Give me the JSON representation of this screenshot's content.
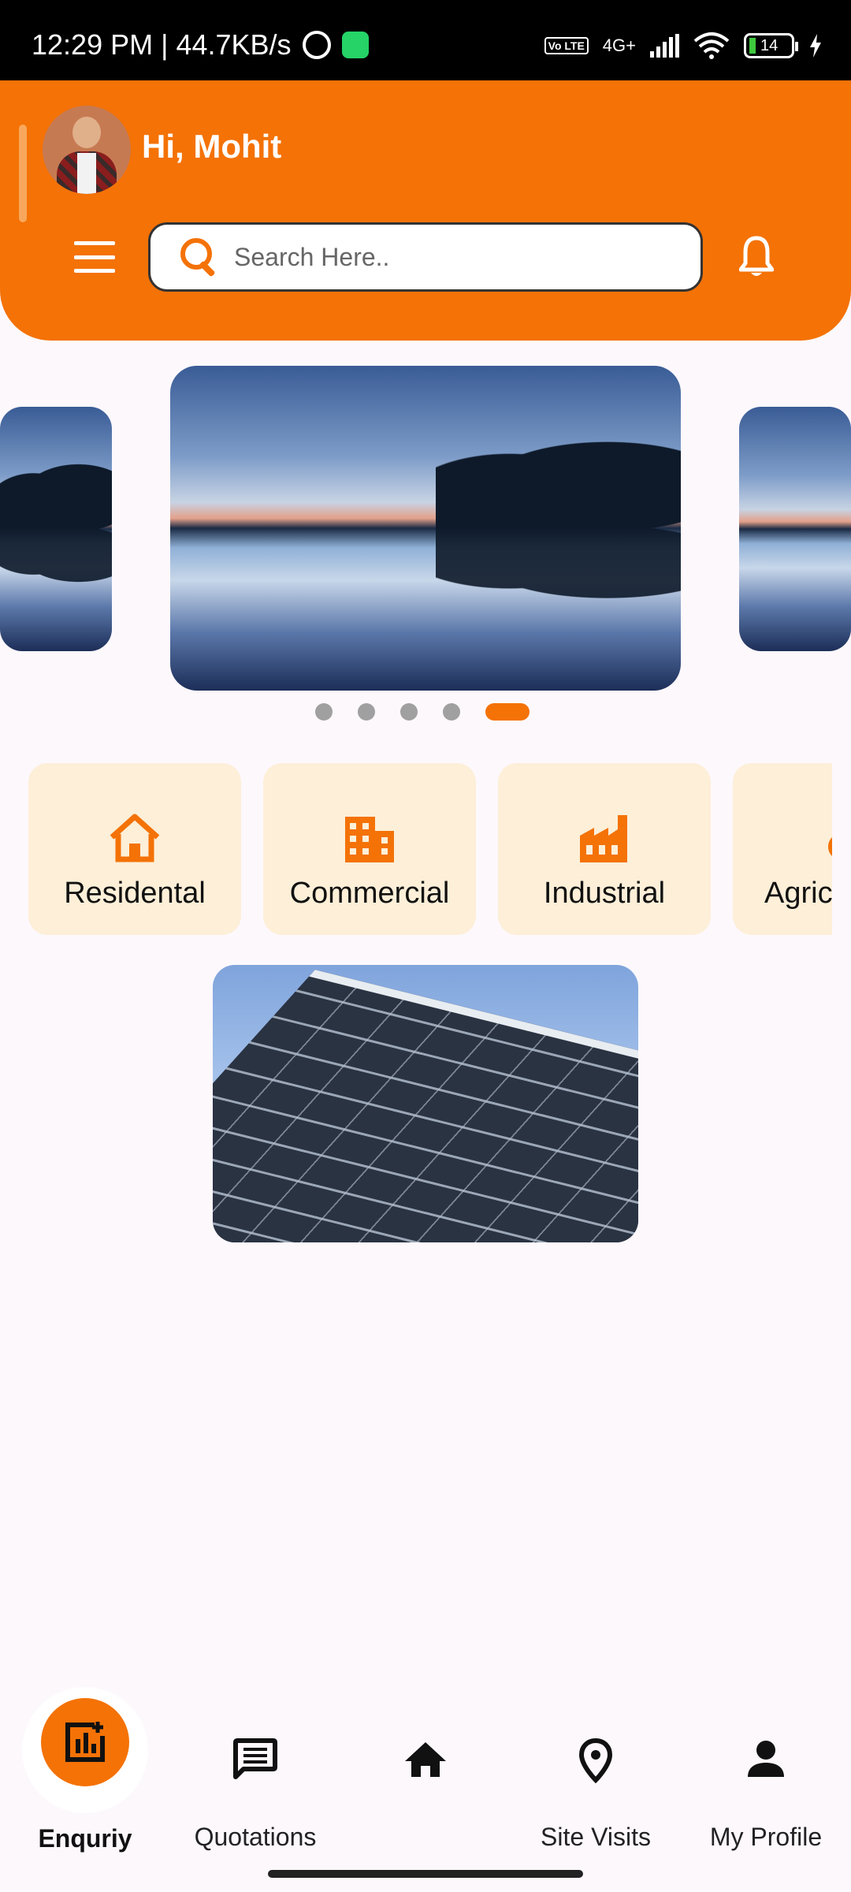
{
  "status_bar": {
    "time_speed": "12:29 PM | 44.7KB/s",
    "network": "4G+",
    "volte": "Vo LTE",
    "battery": "14"
  },
  "header": {
    "greeting": "Hi, Mohit",
    "search_placeholder": "Search Here..",
    "brand_color": "#f47206"
  },
  "carousel": {
    "slide_count": 5,
    "active_index": 4
  },
  "categories": [
    {
      "label": "Residental",
      "icon": "house-icon"
    },
    {
      "label": "Commercial",
      "icon": "building-icon"
    },
    {
      "label": "Industrial",
      "icon": "factory-icon"
    },
    {
      "label": "Agric",
      "icon": "tractor-icon"
    }
  ],
  "bottom_nav": [
    {
      "label": "Enquriy",
      "icon": "add-chart-icon",
      "active": true
    },
    {
      "label": "Quotations",
      "icon": "message-icon"
    },
    {
      "label": "",
      "icon": "home-icon"
    },
    {
      "label": "Site Visits",
      "icon": "location-pin-icon"
    },
    {
      "label": "My Profile",
      "icon": "person-icon"
    }
  ]
}
